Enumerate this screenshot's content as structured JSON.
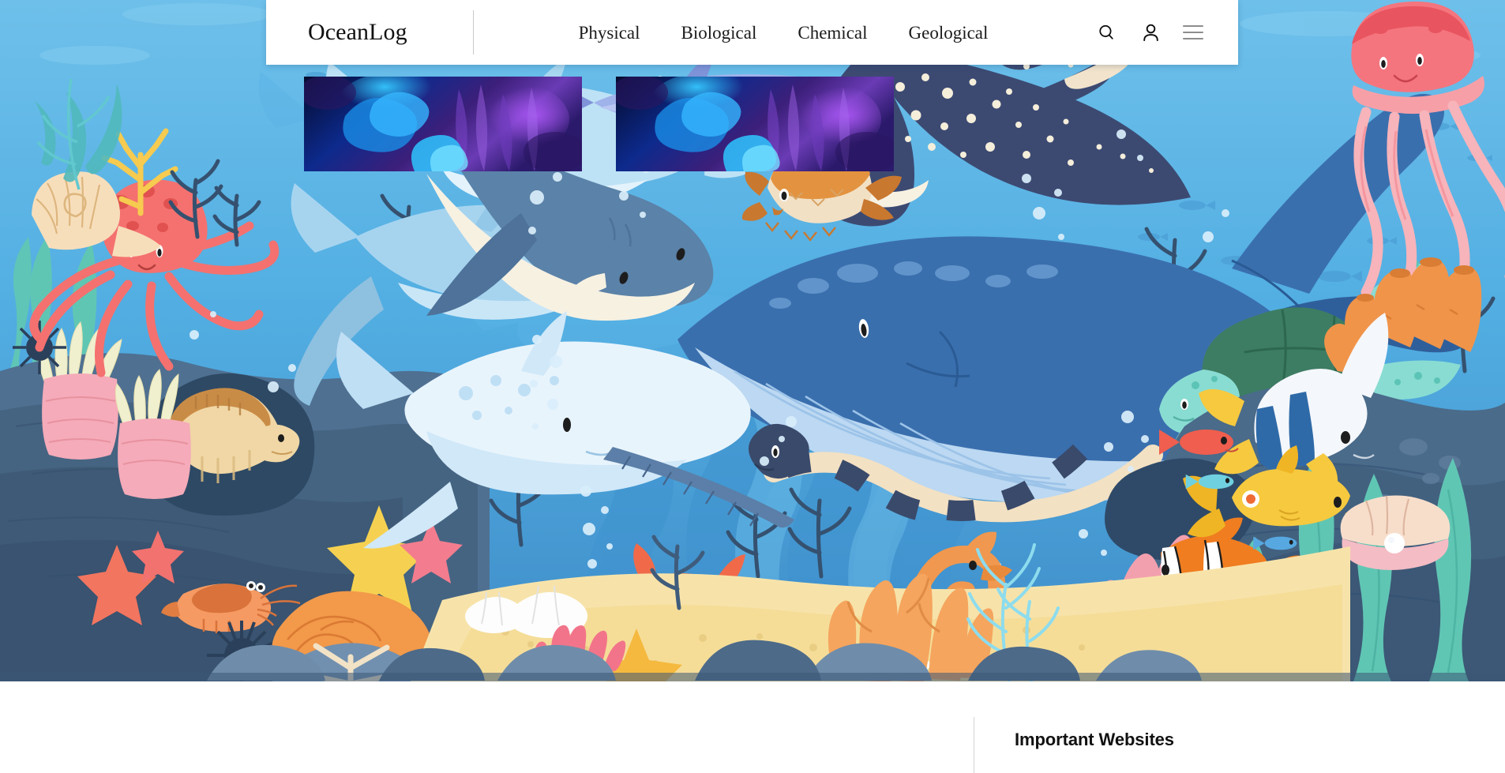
{
  "header": {
    "brand": "OceanLog",
    "nav": [
      {
        "label": "Physical"
      },
      {
        "label": "Biological"
      },
      {
        "label": "Chemical"
      },
      {
        "label": "Geological"
      }
    ],
    "actions": [
      {
        "icon": "search-icon",
        "label": "Search"
      },
      {
        "icon": "user-icon",
        "label": "Account"
      },
      {
        "icon": "hamburger-menu-icon",
        "label": "Menu"
      }
    ]
  },
  "hero": {
    "alt": "Underwater ocean scene illustration",
    "palette": {
      "water_top": "#63b8e8",
      "water_mid": "#4fa8de",
      "water_deep": "#3f87c4",
      "rock_dark": "#3e5f7e",
      "rock_mid": "#4d6d8c",
      "sand": "#f7e3aa",
      "whale_body": "#3a6fae",
      "whale_belly": "#bcd8f2",
      "ray_body": "#3c4a72",
      "coral_orange": "#f0944a",
      "coral_pink": "#f3a0ae",
      "kelp_teal": "#5ec4b3",
      "octopus": "#f4716f",
      "jellyfish": "#f78a92"
    },
    "creatures": [
      "dolphin",
      "dolphin",
      "hammerhead-shark",
      "blue-whale",
      "narwhal",
      "spotted-eagle-ray",
      "barracuda",
      "pufferfish",
      "octopus",
      "sea-turtle",
      "jellyfish",
      "sea-snake",
      "moray-eel",
      "crab",
      "shrimp",
      "seahorse",
      "clownfish",
      "angelfish",
      "yellow-tang",
      "starfish",
      "sea-urchin",
      "nautilus-shell",
      "oyster-pearl",
      "anemone",
      "brain-coral",
      "tube-sponge"
    ]
  },
  "main": {
    "cards": [
      {
        "name": "article-card-1",
        "alt": "Blue coral reef photograph"
      },
      {
        "name": "article-card-2",
        "alt": "Blue coral reef photograph"
      }
    ],
    "sidebar": {
      "title": "Important Websites"
    }
  }
}
